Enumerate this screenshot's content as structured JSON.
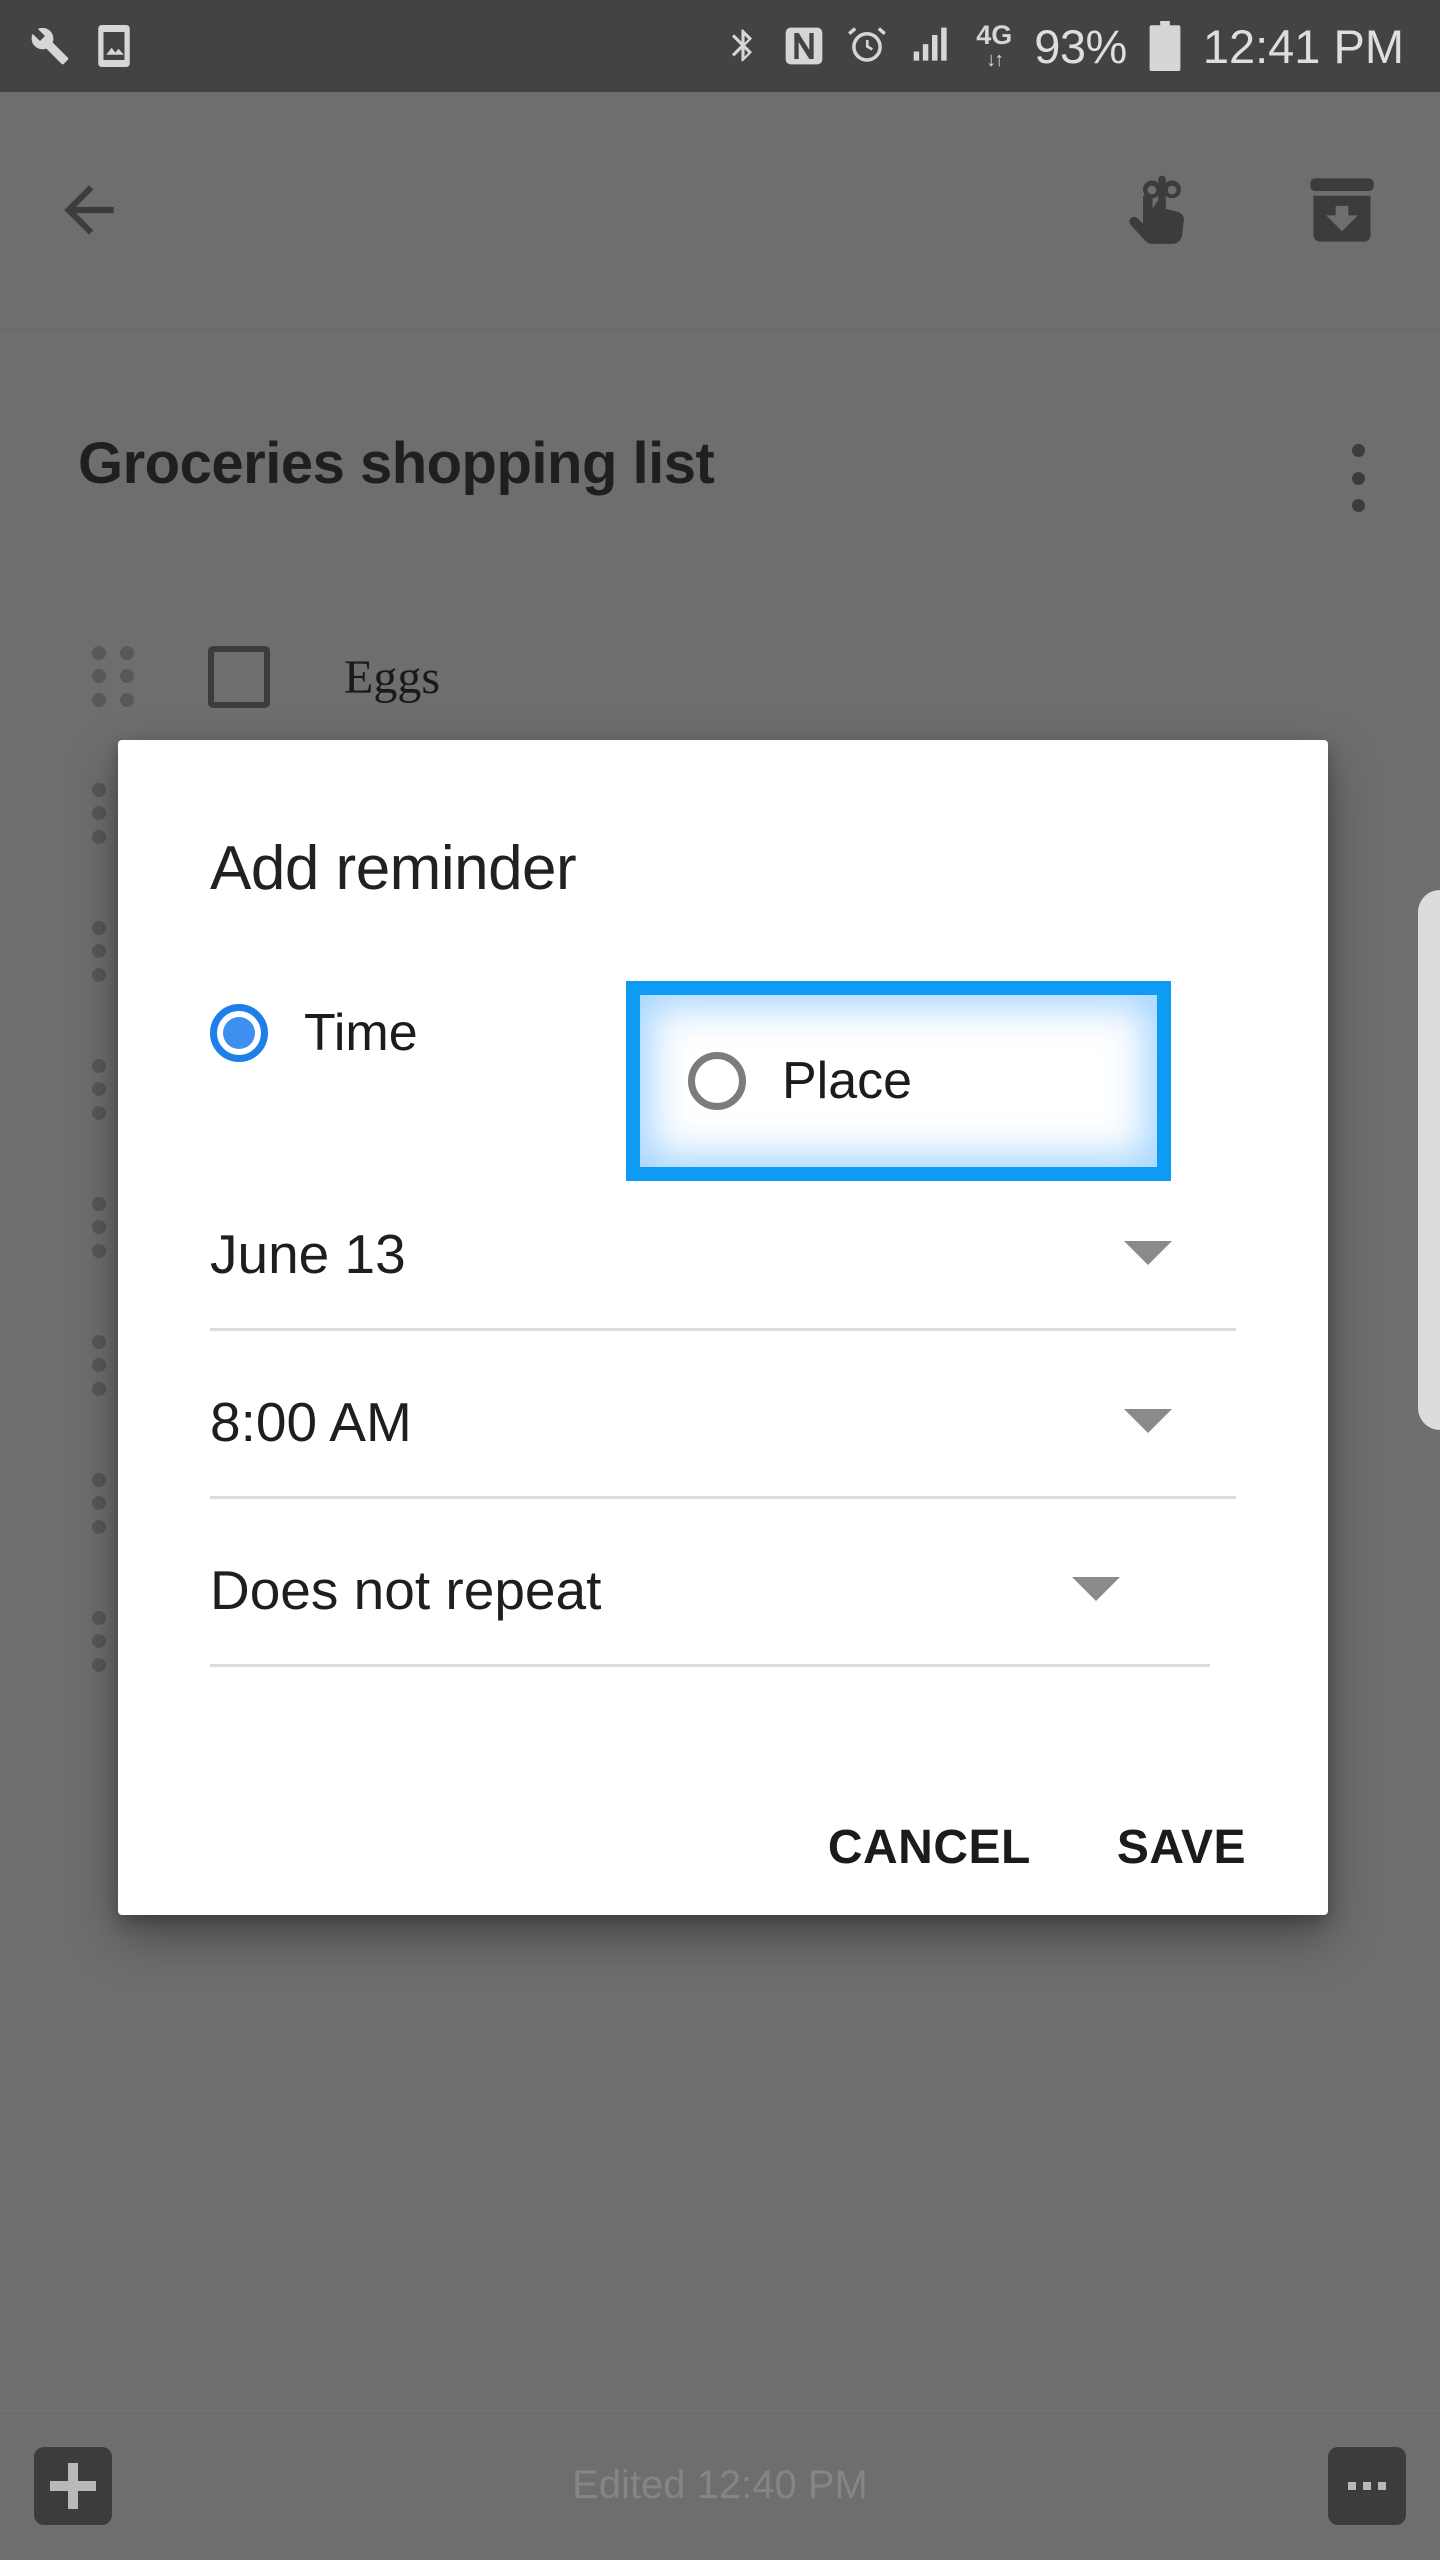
{
  "status_bar": {
    "background": "#434343",
    "left_icons": [
      "wrench-icon",
      "image-icon"
    ],
    "right_icons": [
      "bluetooth-icon",
      "nfc-icon",
      "alarm-icon",
      "signal-icon"
    ],
    "network": "4G",
    "data_arrows": "↓↑",
    "battery_percent": "93%",
    "time": "12:41 PM"
  },
  "toolbar": {
    "background": "#6e6e6e",
    "back_label": "back-arrow",
    "reminder_label": "reminder",
    "archive_label": "archive"
  },
  "note": {
    "title": "Groceries shopping list",
    "items": [
      {
        "label": "Eggs",
        "checked": false
      }
    ],
    "hidden_row_count": 7,
    "edited": "Edited 12:40 PM",
    "add_label": "+",
    "more_label": "more-options"
  },
  "dialog": {
    "title": "Add reminder",
    "accent": "#0d9bf3",
    "options": [
      {
        "label": "Time",
        "selected": true
      },
      {
        "label": "Place",
        "selected": false,
        "highlighted": true
      }
    ],
    "fields": [
      {
        "name": "date",
        "value": "June 13"
      },
      {
        "name": "time",
        "value": "8:00 AM"
      },
      {
        "name": "repeat",
        "value": "Does not repeat"
      }
    ],
    "actions": {
      "cancel": "CANCEL",
      "save": "SAVE"
    }
  }
}
